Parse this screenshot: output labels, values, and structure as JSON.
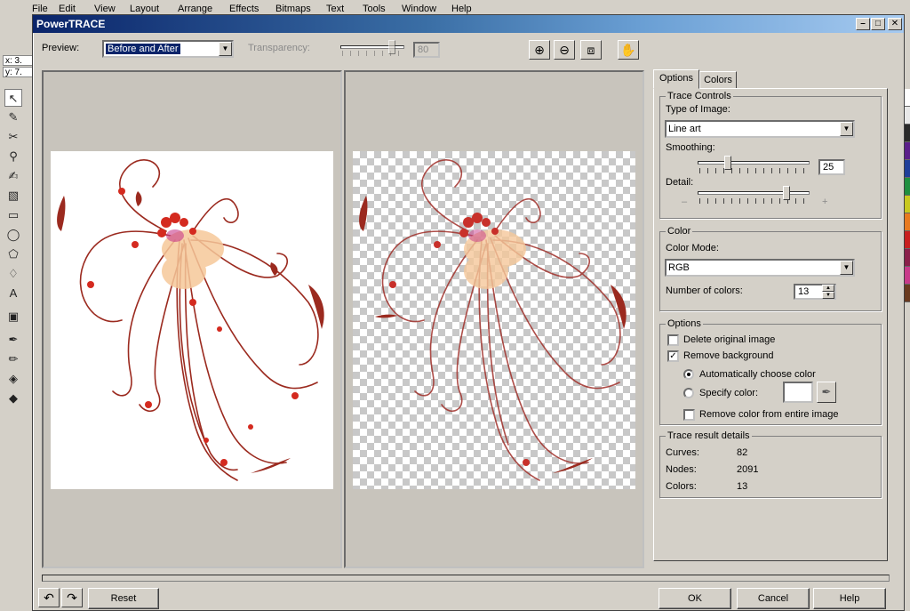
{
  "app": {
    "menu": [
      "File",
      "Edit",
      "View",
      "Layout",
      "Arrange",
      "Effects",
      "Bitmaps",
      "Text",
      "Tools",
      "Window",
      "Help"
    ],
    "coord_x": "x: 3.",
    "coord_y": "y: 7."
  },
  "dialog": {
    "title": "PowerTRACE",
    "preview_label": "Preview:",
    "preview_value": "Before and After",
    "transparency_label": "Transparency:",
    "transparency_value": "80",
    "zoom_in_icon": "zoom-in-icon",
    "zoom_out_icon": "zoom-out-icon",
    "fit_icon": "zoom-fit-icon",
    "pan_icon": "hand-pan-icon"
  },
  "tabs": [
    {
      "label": "Options",
      "active": true
    },
    {
      "label": "Colors",
      "active": false
    }
  ],
  "trace_controls": {
    "title": "Trace Controls",
    "type_label": "Type of Image:",
    "type_value": "Line art",
    "smoothing_label": "Smoothing:",
    "smoothing_value": "25",
    "smoothing_level": 0.25,
    "detail_label": "Detail:",
    "detail_minus": "–",
    "detail_plus": "+",
    "detail_level": 0.8
  },
  "color": {
    "title": "Color",
    "mode_label": "Color Mode:",
    "mode_value": "RGB",
    "num_label": "Number of colors:",
    "num_value": "13"
  },
  "options": {
    "title": "Options",
    "delete_original": {
      "label": "Delete original image",
      "checked": false
    },
    "remove_background": {
      "label": "Remove background",
      "checked": true
    },
    "auto_color": {
      "label": "Automatically choose color",
      "selected": true
    },
    "specify_color": {
      "label": "Specify color:",
      "selected": false
    },
    "remove_entire": {
      "label": "Remove color from entire image",
      "checked": false
    }
  },
  "results": {
    "title": "Trace result details",
    "curves_label": "Curves:",
    "curves_value": "82",
    "nodes_label": "Nodes:",
    "nodes_value": "2091",
    "colors_label": "Colors:",
    "colors_value": "13"
  },
  "footer": {
    "reset_label": "Reset",
    "ok_label": "OK",
    "cancel_label": "Cancel",
    "help_label": "Help"
  },
  "palette_colors": [
    "#ffffff",
    "#e8e8e8",
    "#2a2a2a",
    "#5b1f8a",
    "#1f3f9a",
    "#1f8f3f",
    "#c8c81f",
    "#e87a1f",
    "#c81f1f",
    "#8a1f4a",
    "#c83a8a",
    "#6a3a1f"
  ]
}
